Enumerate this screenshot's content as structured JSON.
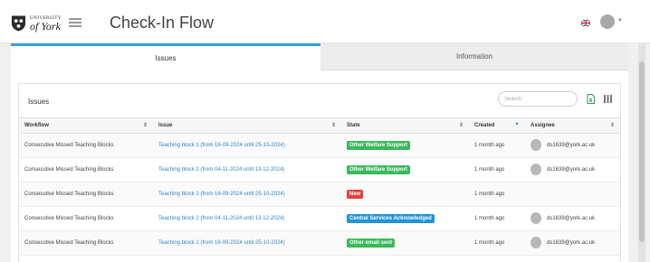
{
  "app": {
    "title": "Check-In Flow",
    "logo": {
      "line1": "UNIVERSITY",
      "line2": "of York"
    }
  },
  "tabs": [
    {
      "label": "Issues",
      "active": true
    },
    {
      "label": "Information",
      "active": false
    }
  ],
  "panel": {
    "title": "Issues",
    "search_placeholder": "Search"
  },
  "table": {
    "columns": [
      "Workflow",
      "Issue",
      "State",
      "Created",
      "Assignee"
    ],
    "sorted_column": "Created",
    "rows": [
      {
        "workflow": "Consecutive Missed Teaching Blocks",
        "issue": "Teaching block 1 (from 16-09-2024 until 25-10-2024)",
        "state": "Other Welfare Support",
        "state_color": "#3cb85b",
        "created": "1 month ago",
        "assignee": "ds1639@york.ac.uk"
      },
      {
        "workflow": "Consecutive Missed Teaching Blocks",
        "issue": "Teaching block 2 (from 04-11-2024 until 13-12-2024)",
        "state": "Other Welfare Support",
        "state_color": "#3cb85b",
        "created": "1 month ago",
        "assignee": "ds1639@york.ac.uk"
      },
      {
        "workflow": "Consecutive Missed Teaching Blocks",
        "issue": "Teaching block 1 (from 16-09-2024 until 25-10-2024)",
        "state": "New",
        "state_color": "#e4403b",
        "created": "1 month ago",
        "assignee": ""
      },
      {
        "workflow": "Consecutive Missed Teaching Blocks",
        "issue": "Teaching block 2 (from 04-11-2024 until 13-12-2024)",
        "state": "Central Services Acknowledged",
        "state_color": "#2493d6",
        "created": "1 month ago",
        "assignee": "ds1639@york.ac.uk"
      },
      {
        "workflow": "Consecutive Missed Teaching Blocks",
        "issue": "Teaching block 1 (from 16-09-2024 until 25-10-2024)",
        "state": "Other email sent",
        "state_color": "#3cb85b",
        "created": "1 month ago",
        "assignee": "ds1639@york.ac.uk"
      }
    ]
  },
  "colors": {
    "accent": "#3aa0d8",
    "link": "#2f86c8"
  }
}
